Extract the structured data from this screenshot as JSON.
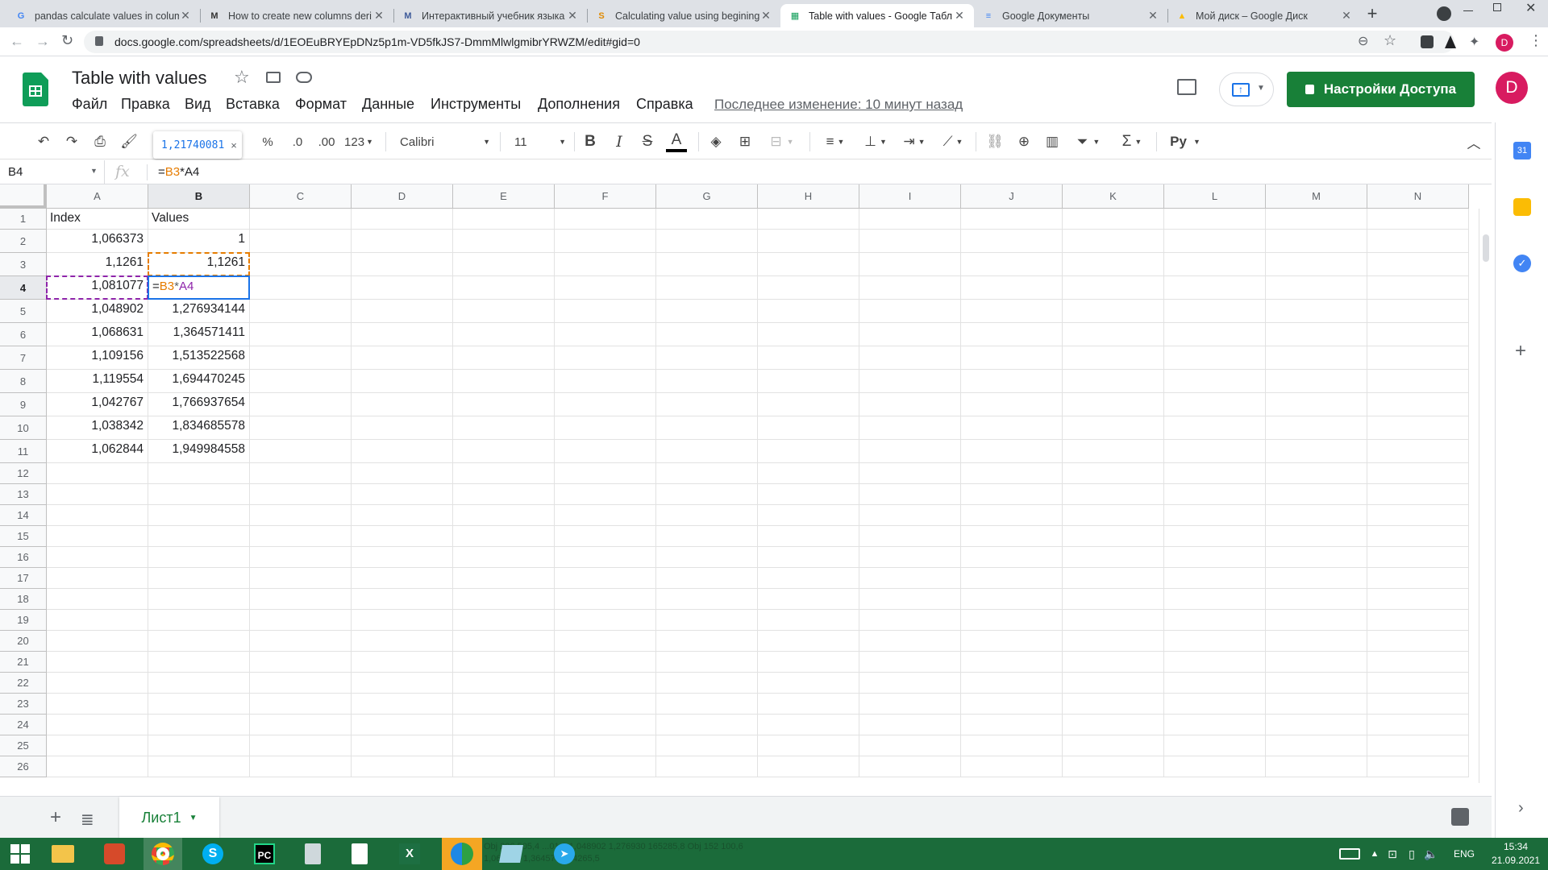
{
  "browser": {
    "tabs": [
      {
        "title": "pandas calculate values in colum",
        "favicon": "google-icon",
        "color": "#4285f4",
        "glyph": "G"
      },
      {
        "title": "How to create new columns deri",
        "favicon": "medium-icon",
        "color": "#333333",
        "glyph": "M"
      },
      {
        "title": "Интерактивный учебник языка",
        "favicon": "medium-icon",
        "color": "#3d5a99",
        "glyph": "M"
      },
      {
        "title": "Calculating value using begining",
        "favicon": "stack-icon",
        "color": "#e08a00",
        "glyph": "S"
      },
      {
        "title": "Table with values - Google Табл",
        "favicon": "sheets-icon",
        "color": "#0f9d58",
        "glyph": "▦",
        "active": true
      },
      {
        "title": "Google Документы",
        "favicon": "docs-icon",
        "color": "#4285f4",
        "glyph": "≡"
      },
      {
        "title": "Мой диск – Google Диск",
        "favicon": "drive-icon",
        "color": "#fbbc04",
        "glyph": "▲"
      }
    ],
    "url": "docs.google.com/spreadsheets/d/1EOEuBRYEpDNz5p1m-VD5fkJS7-DmmMlwlgmibrYRWZM/edit#gid=0",
    "profile_initial": "D"
  },
  "doc": {
    "title": "Table with values",
    "menu": [
      "Файл",
      "Правка",
      "Вид",
      "Вставка",
      "Формат",
      "Данные",
      "Инструменты",
      "Дополнения",
      "Справка"
    ],
    "last_edit": "Последнее изменение: 10 минут назад",
    "share_label": "Настройки Доступа",
    "avatar_initial": "D"
  },
  "toolbar": {
    "percent": "%",
    "dec_less": ".0",
    "dec_more": ".00",
    "format_more": "123",
    "font": "Calibri",
    "font_size": "11",
    "tooltip_value": "1,21740081",
    "tooltip_close": "×",
    "input_tools": "Ру"
  },
  "formula_bar": {
    "name_box": "B4",
    "fx": "fx",
    "eq": "=",
    "ref1": "B3",
    "op": "*",
    "ref2": "A4"
  },
  "grid": {
    "columns": [
      "A",
      "B",
      "C",
      "D",
      "E",
      "F",
      "G",
      "H",
      "I",
      "J",
      "K",
      "L",
      "M",
      "N"
    ],
    "rows": [
      "1",
      "2",
      "3",
      "4",
      "5",
      "6",
      "7",
      "8",
      "9",
      "10",
      "11",
      "12",
      "13",
      "14",
      "15",
      "16",
      "17",
      "18",
      "19",
      "20",
      "21",
      "22",
      "23",
      "24",
      "25",
      "26"
    ],
    "cells": {
      "A1": "Index",
      "B1": "Values",
      "A2": "1,066373",
      "B2": "1",
      "A3": "1,1261",
      "B3": "1,1261",
      "A4": "1,081077",
      "B4": "",
      "A5": "1,048902",
      "B5": "1,276934144",
      "A6": "1,068631",
      "B6": "1,364571411",
      "A7": "1,109156",
      "B7": "1,513522568",
      "A8": "1,119554",
      "B8": "1,694470245",
      "A9": "1,042767",
      "B9": "1,766937654",
      "A10": "1,038342",
      "B10": "1,834685578",
      "A11": "1,062844",
      "B11": "1,949984558"
    },
    "editing_cell": "B4",
    "edit_eq": "=",
    "edit_ref1": "B3",
    "edit_op": "*",
    "edit_ref2": "A4"
  },
  "sheets": {
    "add": "+",
    "tab": "Лист1"
  },
  "taskbar": {
    "lang": "ENG",
    "time": "15:34",
    "date": "21.09.2021",
    "bg_text": "Obj 206 505,4  ...01,8  1,048902  1,276930  165285,8  Obj 152  100,6  1,068631  1,364573  164265,5"
  },
  "colors": {
    "sheets_green": "#0f9d58",
    "share_green": "#188038",
    "select_blue": "#1a73e8",
    "ref_orange": "#e67c00",
    "ref_purple": "#8e24aa"
  }
}
